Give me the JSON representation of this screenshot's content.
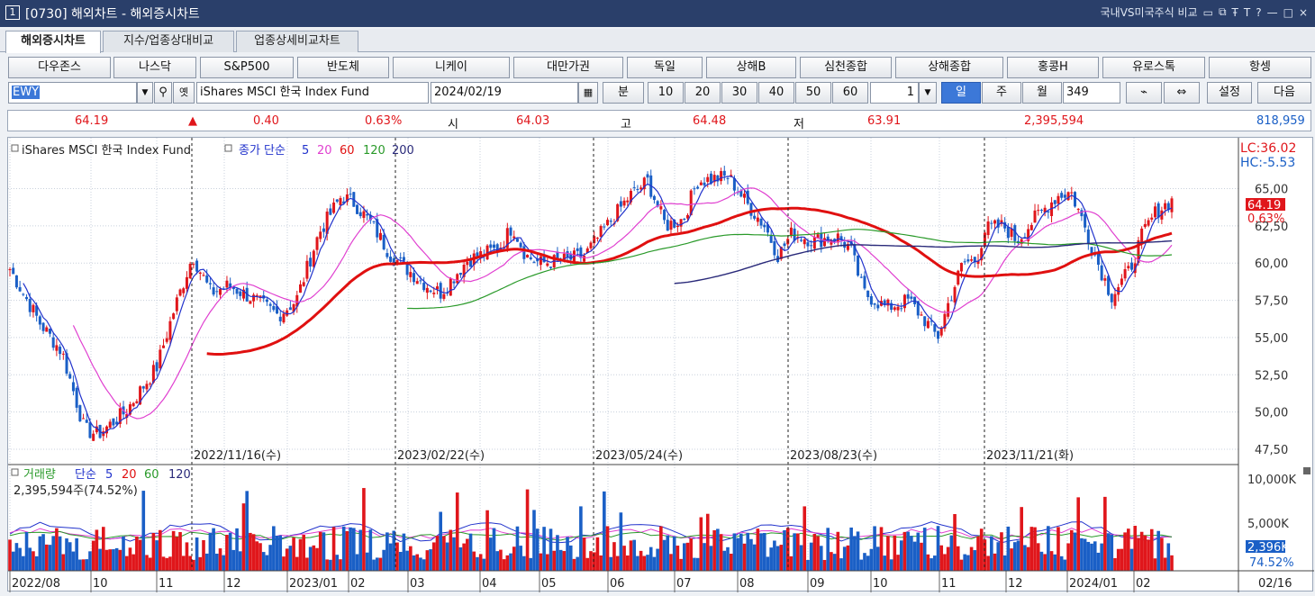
{
  "window": {
    "title_num": "1",
    "title": "[0730] 해외차트 - 해외증시차트",
    "right_label": "국내VS미국주식 비교",
    "controls": [
      "▭",
      "⧉",
      "Ŧ",
      "T",
      "?",
      "—",
      "□",
      "×"
    ]
  },
  "tabs": [
    "해외증시차트",
    "지수/업종상대비교",
    "업종상세비교차트"
  ],
  "markets": [
    "다우존스",
    "나스닥",
    "S&P500",
    "반도체",
    "니케이",
    "대만가권",
    "독일",
    "상해B",
    "심천종합",
    "상해종합",
    "홍콩H",
    "유로스톡",
    "항셍"
  ],
  "controls": {
    "symbol": "EWY",
    "name": "iShares MSCI 한국 Index Fund",
    "date": "2024/02/19",
    "minute_label": "분",
    "minutes": [
      "10",
      "20",
      "30",
      "40",
      "50",
      "60"
    ],
    "spin": "1",
    "periods": [
      "일",
      "주",
      "월"
    ],
    "count": "349",
    "settings": "설정",
    "next": "다음"
  },
  "quote": {
    "price": "64.19",
    "arrow": "▲",
    "change": "0.40",
    "pct": "0.63%",
    "open_label": "시",
    "open": "64.03",
    "high_label": "고",
    "high": "64.48",
    "low_label": "저",
    "low": "63.91",
    "volume": "2,395,594",
    "amount": "818,959"
  },
  "chart": {
    "legend_name": "iShares MSCI 한국 Index Fund",
    "ma_label": "종가 단순",
    "ma": [
      "5",
      "20",
      "60",
      "120",
      "200"
    ],
    "lc": "LC:36.02",
    "hc": "HC:-5.53",
    "price_tag": "64.19",
    "pct_tag": "0.63%",
    "y_ticks": [
      "65,00",
      "62,50",
      "60,00",
      "57,50",
      "55,00",
      "52,50",
      "50,00",
      "47,50"
    ],
    "dates": [
      "2022/11/16(수)",
      "2023/02/22(수)",
      "2023/05/24(수)",
      "2023/08/23(수)",
      "2023/11/21(화)"
    ],
    "vol_label": "거래량",
    "vol_ma_label": "단순",
    "vol_ma": [
      "5",
      "20",
      "60",
      "120"
    ],
    "vol_info": "2,395,594주(74.52%)",
    "vol_ticks": [
      "10,000K",
      "5,000K"
    ],
    "vol_tag": "2,396K",
    "vol_pct_tag": "74.52%",
    "x_labels": [
      "2022/08",
      "10",
      "11",
      "12",
      "2023/01",
      "02",
      "03",
      "04",
      "05",
      "06",
      "07",
      "08",
      "09",
      "10",
      "11",
      "12",
      "2024/01",
      "02"
    ],
    "x_last": "02/16"
  },
  "colors": {
    "up": "#e0161b",
    "down": "#1a5fc6",
    "ma5": "#2233cc",
    "ma20": "#e040d0",
    "ma60": "#e01010",
    "ma120": "#2a9a2a",
    "ma200": "#2a2a7a"
  }
}
